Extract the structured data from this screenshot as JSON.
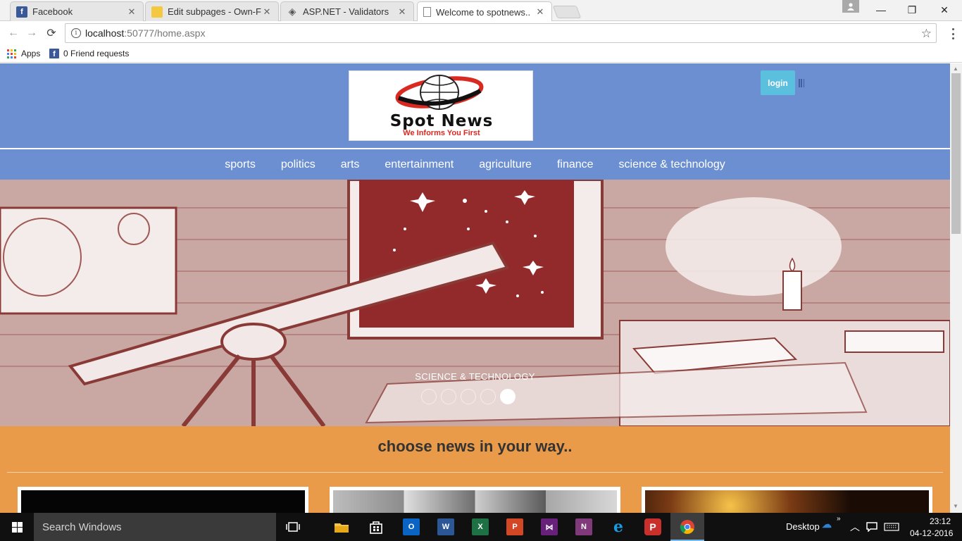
{
  "browser": {
    "tabs": [
      {
        "title": "Facebook",
        "icon": "facebook-icon",
        "active": false
      },
      {
        "title": "Edit subpages - Own-Fre",
        "icon": "folder-icon",
        "active": false
      },
      {
        "title": "ASP.NET - Validators",
        "icon": "gear-icon",
        "active": false
      },
      {
        "title": "Welcome to spotnews..",
        "icon": "page-icon",
        "active": true
      }
    ],
    "url_host": "localhost",
    "url_path": ":50777/home.aspx",
    "bookmarks": [
      {
        "label": "Apps"
      },
      {
        "label": "0 Friend requests"
      }
    ]
  },
  "site": {
    "logo": {
      "name": "Spot News",
      "tagline": "We Informs You First"
    },
    "login_label": "login",
    "nav": [
      "sports",
      "politics",
      "arts",
      "entertainment",
      "agriculture",
      "finance",
      "science & technology"
    ],
    "carousel": {
      "caption": "SCIENCE & TECHNOLOGY",
      "slide_count": 5,
      "active_index": 4
    },
    "section_title": "choose news in your way..",
    "colors": {
      "header": "#6b8fd1",
      "section": "#e99b4a",
      "login": "#5bc0de"
    }
  },
  "taskbar": {
    "search_placeholder": "Search Windows",
    "apps": [
      "task-view-icon",
      "file-explorer-icon",
      "store-icon",
      "outlook-icon",
      "word-icon",
      "excel-icon",
      "powerpoint-icon",
      "visual-studio-icon",
      "onenote-icon",
      "edge-icon",
      "pinterest-icon",
      "chrome-icon"
    ],
    "desktop_label": "Desktop",
    "time": "23:12",
    "date": "04-12-2016"
  }
}
